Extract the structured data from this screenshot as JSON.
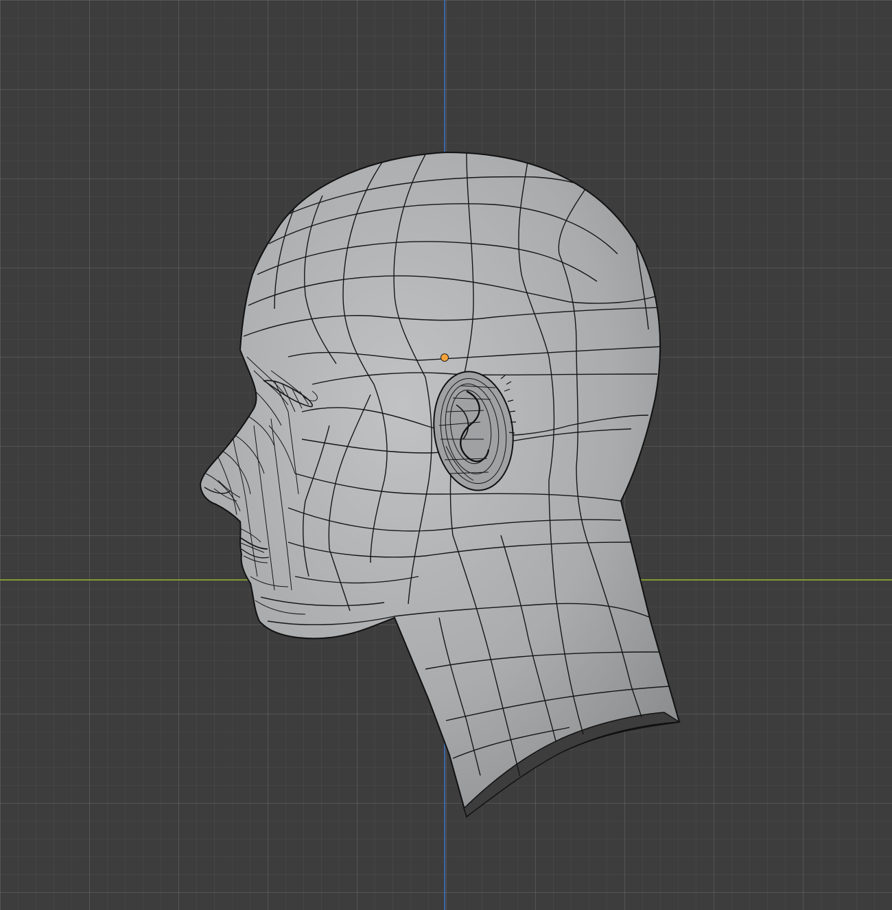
{
  "viewport": {
    "background_color": "#3d3d3d",
    "grid_color": "#4a4a4a",
    "axis_x_color": "#7f9d31",
    "axis_z_color": "#3e66a6"
  },
  "mesh": {
    "object": "head",
    "fill_color": "#a9abad",
    "wire_color": "#111111",
    "origin_color": "#f3a23b"
  }
}
